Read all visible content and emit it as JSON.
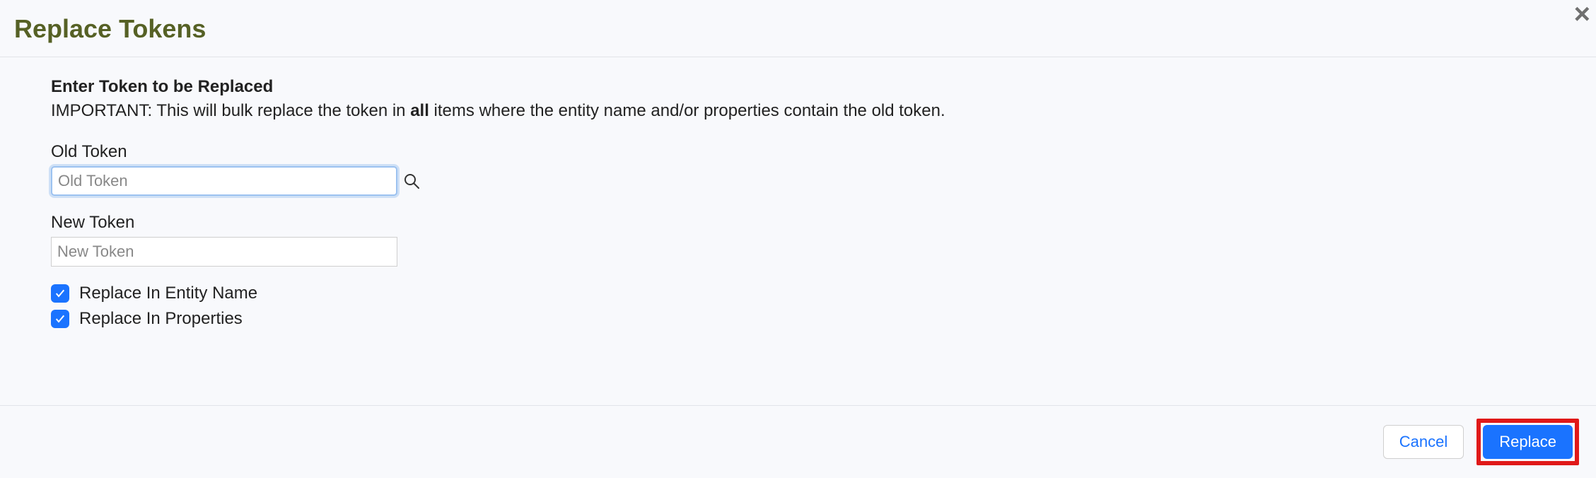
{
  "header": {
    "title": "Replace Tokens"
  },
  "body": {
    "section_title": "Enter Token to be Replaced",
    "important_prefix": "IMPORTANT: This will bulk replace the token in ",
    "important_bold": "all",
    "important_suffix": " items where the entity name and/or properties contain the old token.",
    "old_token": {
      "label": "Old Token",
      "placeholder": "Old Token",
      "value": ""
    },
    "new_token": {
      "label": "New Token",
      "placeholder": "New Token",
      "value": ""
    },
    "checks": {
      "entity": {
        "label": "Replace In Entity Name",
        "checked": true
      },
      "properties": {
        "label": "Replace In Properties",
        "checked": true
      }
    }
  },
  "footer": {
    "cancel": "Cancel",
    "replace": "Replace"
  }
}
